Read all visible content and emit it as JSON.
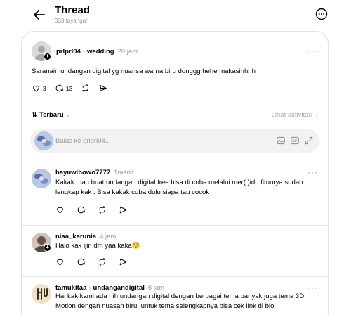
{
  "header": {
    "title": "Thread",
    "views": "333 tayangan"
  },
  "op": {
    "username": "prlprl04",
    "tag": "wedding",
    "time": "20 jam",
    "text": "Saranain undangan digital yg nuansa warna biru donggg hehe makasihhhh",
    "likes": "3",
    "replies": "13"
  },
  "sort": {
    "label": "Terbaru",
    "activity": "Lihat aktivitas"
  },
  "reply_box": {
    "placeholder": "Balas ke prlprl04..."
  },
  "comments": [
    {
      "username": "bayuwibowo7777",
      "time": "1menit",
      "text": "Kakak mau buat undangan digital free bisa di coba melalui mer(.)id , fiturnya sudah lengkap kak . Bisa kakak coba dulu siapa tau cocok"
    },
    {
      "username": "niaa_karunia",
      "time": "4 jam",
      "text": "Halo kak ijin dm yaa kaka☺️"
    },
    {
      "username": "tamukitaa",
      "tag": "undangandigital",
      "time": "6 jam",
      "text": "Hai kak kami ada nih undangan digital dengan berbagai tema banyak juga tema 3D Motion dengan nuasan biru, untuk tema selengkapnya bisa cek link di bio"
    }
  ],
  "colors": {
    "accent": "#000000",
    "muted": "#999999",
    "border": "#e1e1e1",
    "input_bg": "#f2f2f2"
  }
}
